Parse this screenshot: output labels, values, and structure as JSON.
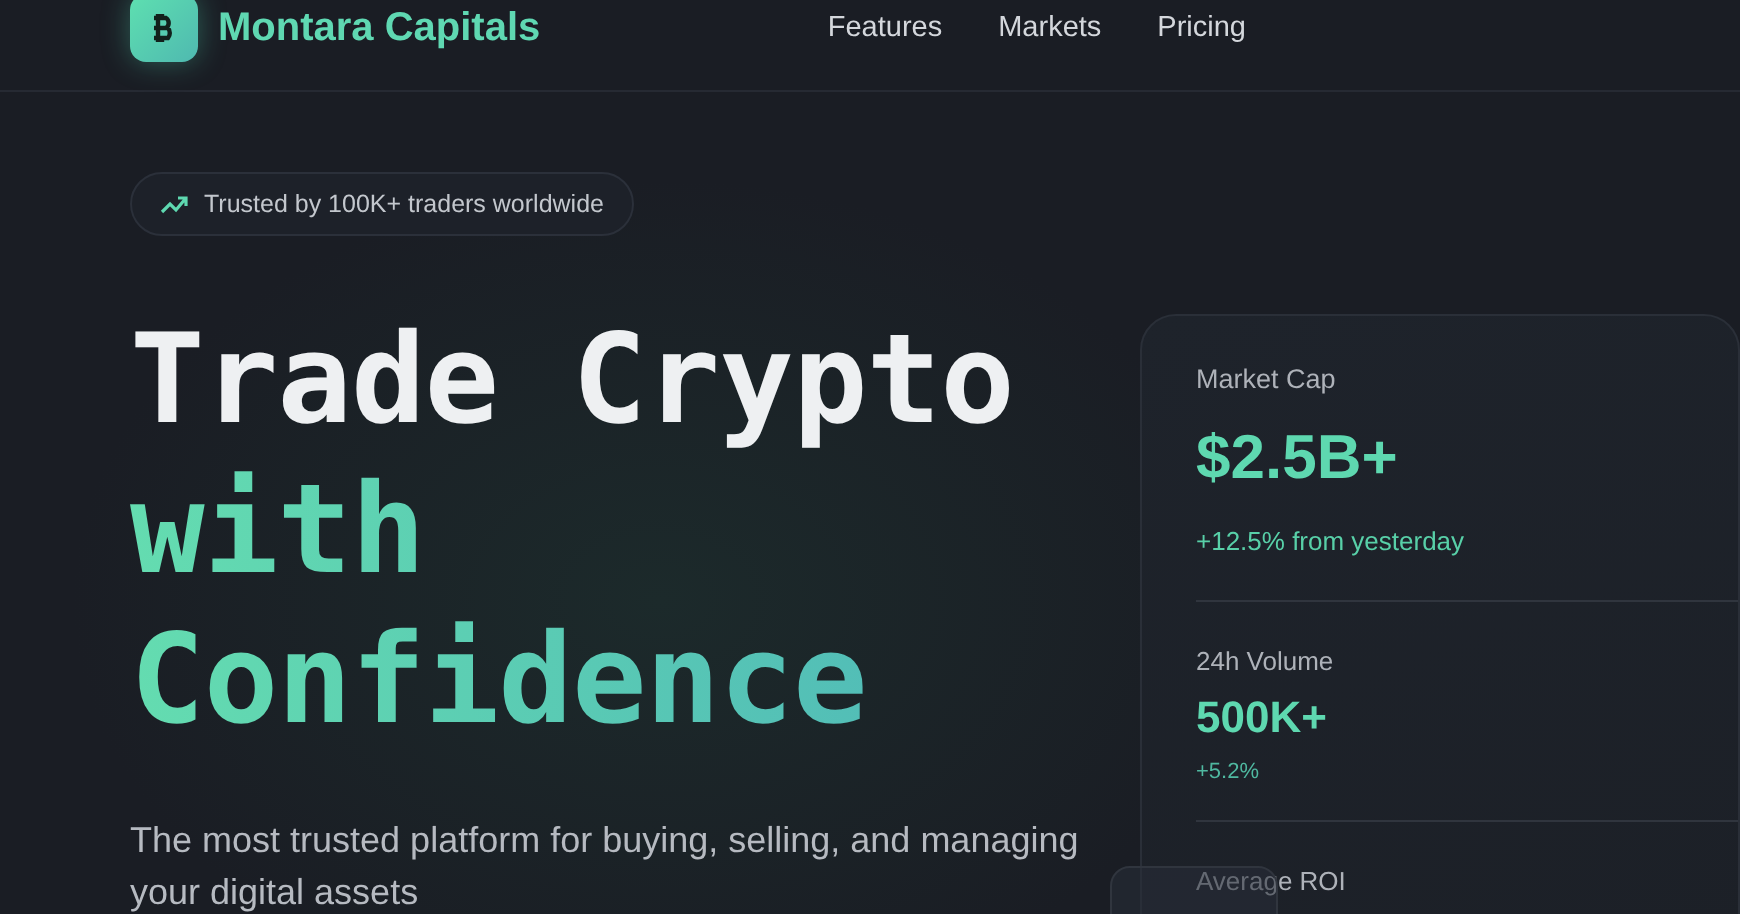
{
  "brand": {
    "name": "Montara Capitals"
  },
  "nav": [
    {
      "label": "Features"
    },
    {
      "label": "Markets"
    },
    {
      "label": "Pricing"
    }
  ],
  "badge": {
    "text": "Trusted by 100K+ traders worldwide"
  },
  "headline": {
    "lines": [
      {
        "text": "Trade Crypto",
        "accent": false
      },
      {
        "text": "with",
        "accent": true
      },
      {
        "text": "Confidence",
        "accent": true
      }
    ]
  },
  "subtitle": "The most trusted platform for buying, selling, and managing your digital assets",
  "stats": [
    {
      "label": "Market Cap",
      "value": "$2.5B+",
      "change": "+12.5% from yesterday",
      "kind": "primary"
    },
    {
      "label": "24h Volume",
      "value": "500K+",
      "change": "+5.2%",
      "kind": "secondary"
    },
    {
      "label": "Average ROI",
      "kind": "secondary"
    }
  ]
}
